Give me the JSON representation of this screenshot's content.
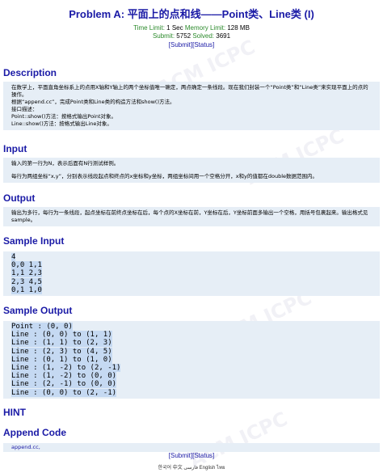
{
  "problem": {
    "title": "Problem A: 平面上的点和线——Point类、Line类 (I)",
    "time_limit_label": "Time Limit:",
    "time_limit": "1 Sec",
    "memory_limit_label": "Memory Limit:",
    "memory_limit": "128 MB",
    "submit_label": "Submit:",
    "submit_count": "5752",
    "solved_label": "Solved:",
    "solved_count": "3691",
    "submit_link": "[Submit]",
    "status_link": "[Status]"
  },
  "sections": {
    "description_title": "Description",
    "description_lines": [
      "在数学上，平面直角坐标系上的点用X轴和Y轴上的两个坐标值唯一确定，两点确定一条线段。现在我们封装一个“Point类”和“Line类”来实现平面上的点的操作。",
      "根据“append.cc”，完成Point类和Line类的构造方法和show()方法。",
      "接口描述：",
      "Point::show()方法：按格式输出Point对象。",
      "Line::show()方法：按格式输出Line对象。"
    ],
    "input_title": "Input",
    "input_lines": [
      "输入的第一行为N，表示后面有N行测试样例。",
      "每行为两组坐标“x,y”，分别表示线段起点和终点的x坐标和y坐标，两组坐标间用一个空格分开，x和y的值都在double数据范围内。"
    ],
    "output_title": "Output",
    "output_lines": [
      "输出为多行，每行为一条线段，起点坐标在前终点坐标在后，每个点的X坐标在前，Y坐标在后，Y坐标前面多输出一个空格，用括号包裹起来。输出格式见sample。"
    ],
    "sample_input_title": "Sample Input",
    "sample_input": [
      "4",
      "0,0 1,1",
      "1,1 2,3",
      "2,3 4,5",
      "0,1 1,0"
    ],
    "sample_output_title": "Sample Output",
    "sample_output": [
      "Point : (0, 0)",
      "Line : (0, 0) to (1, 1)",
      "Line : (1, 1) to (2, 3)",
      "Line : (2, 3) to (4, 5)",
      "Line : (0, 1) to (1, 0)",
      "Line : (1, -2) to (2, -1)",
      "Line : (1, -2) to (0, 0)",
      "Line : (2, -1) to (0, 0)",
      "Line : (0, 0) to (2, -1)"
    ],
    "hint_title": "HINT",
    "append_title": "Append Code",
    "append_lines": [
      "append.cc,"
    ]
  },
  "footer": {
    "submit_link": "[Submit]",
    "status_link": "[Status]",
    "languages": [
      "한국어",
      "中文",
      "فارسی",
      "English",
      "ไทย"
    ]
  },
  "watermark": "ACM ICPC"
}
